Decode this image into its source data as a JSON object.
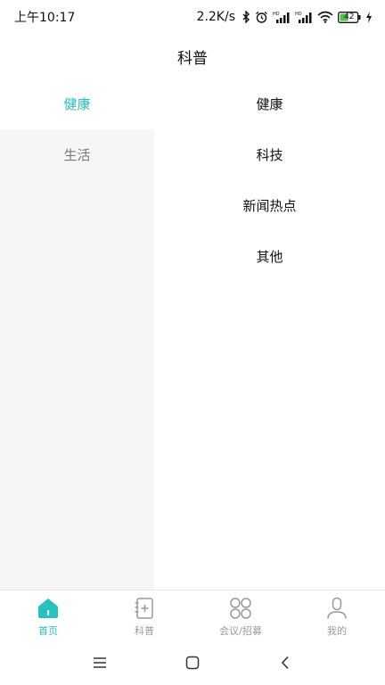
{
  "status_bar": {
    "time": "上午10:17",
    "net_speed": "2.2K/s",
    "battery": "42"
  },
  "header": {
    "title": "科普"
  },
  "categories": [
    {
      "label": "健康",
      "active": true
    },
    {
      "label": "生活",
      "active": false
    }
  ],
  "subcategories": [
    {
      "label": "健康"
    },
    {
      "label": "科技"
    },
    {
      "label": "新闻热点"
    },
    {
      "label": "其他"
    }
  ],
  "tabs": [
    {
      "label": "首页",
      "icon": "home-icon",
      "active": true
    },
    {
      "label": "科普",
      "icon": "notebook-plus-icon",
      "active": false
    },
    {
      "label": "会议/招募",
      "icon": "four-circles-icon",
      "active": false
    },
    {
      "label": "我的",
      "icon": "person-icon",
      "active": false
    }
  ],
  "colors": {
    "accent": "#26c1c1",
    "inactive": "#999999",
    "left_pane_bg": "#f6f6f6"
  }
}
